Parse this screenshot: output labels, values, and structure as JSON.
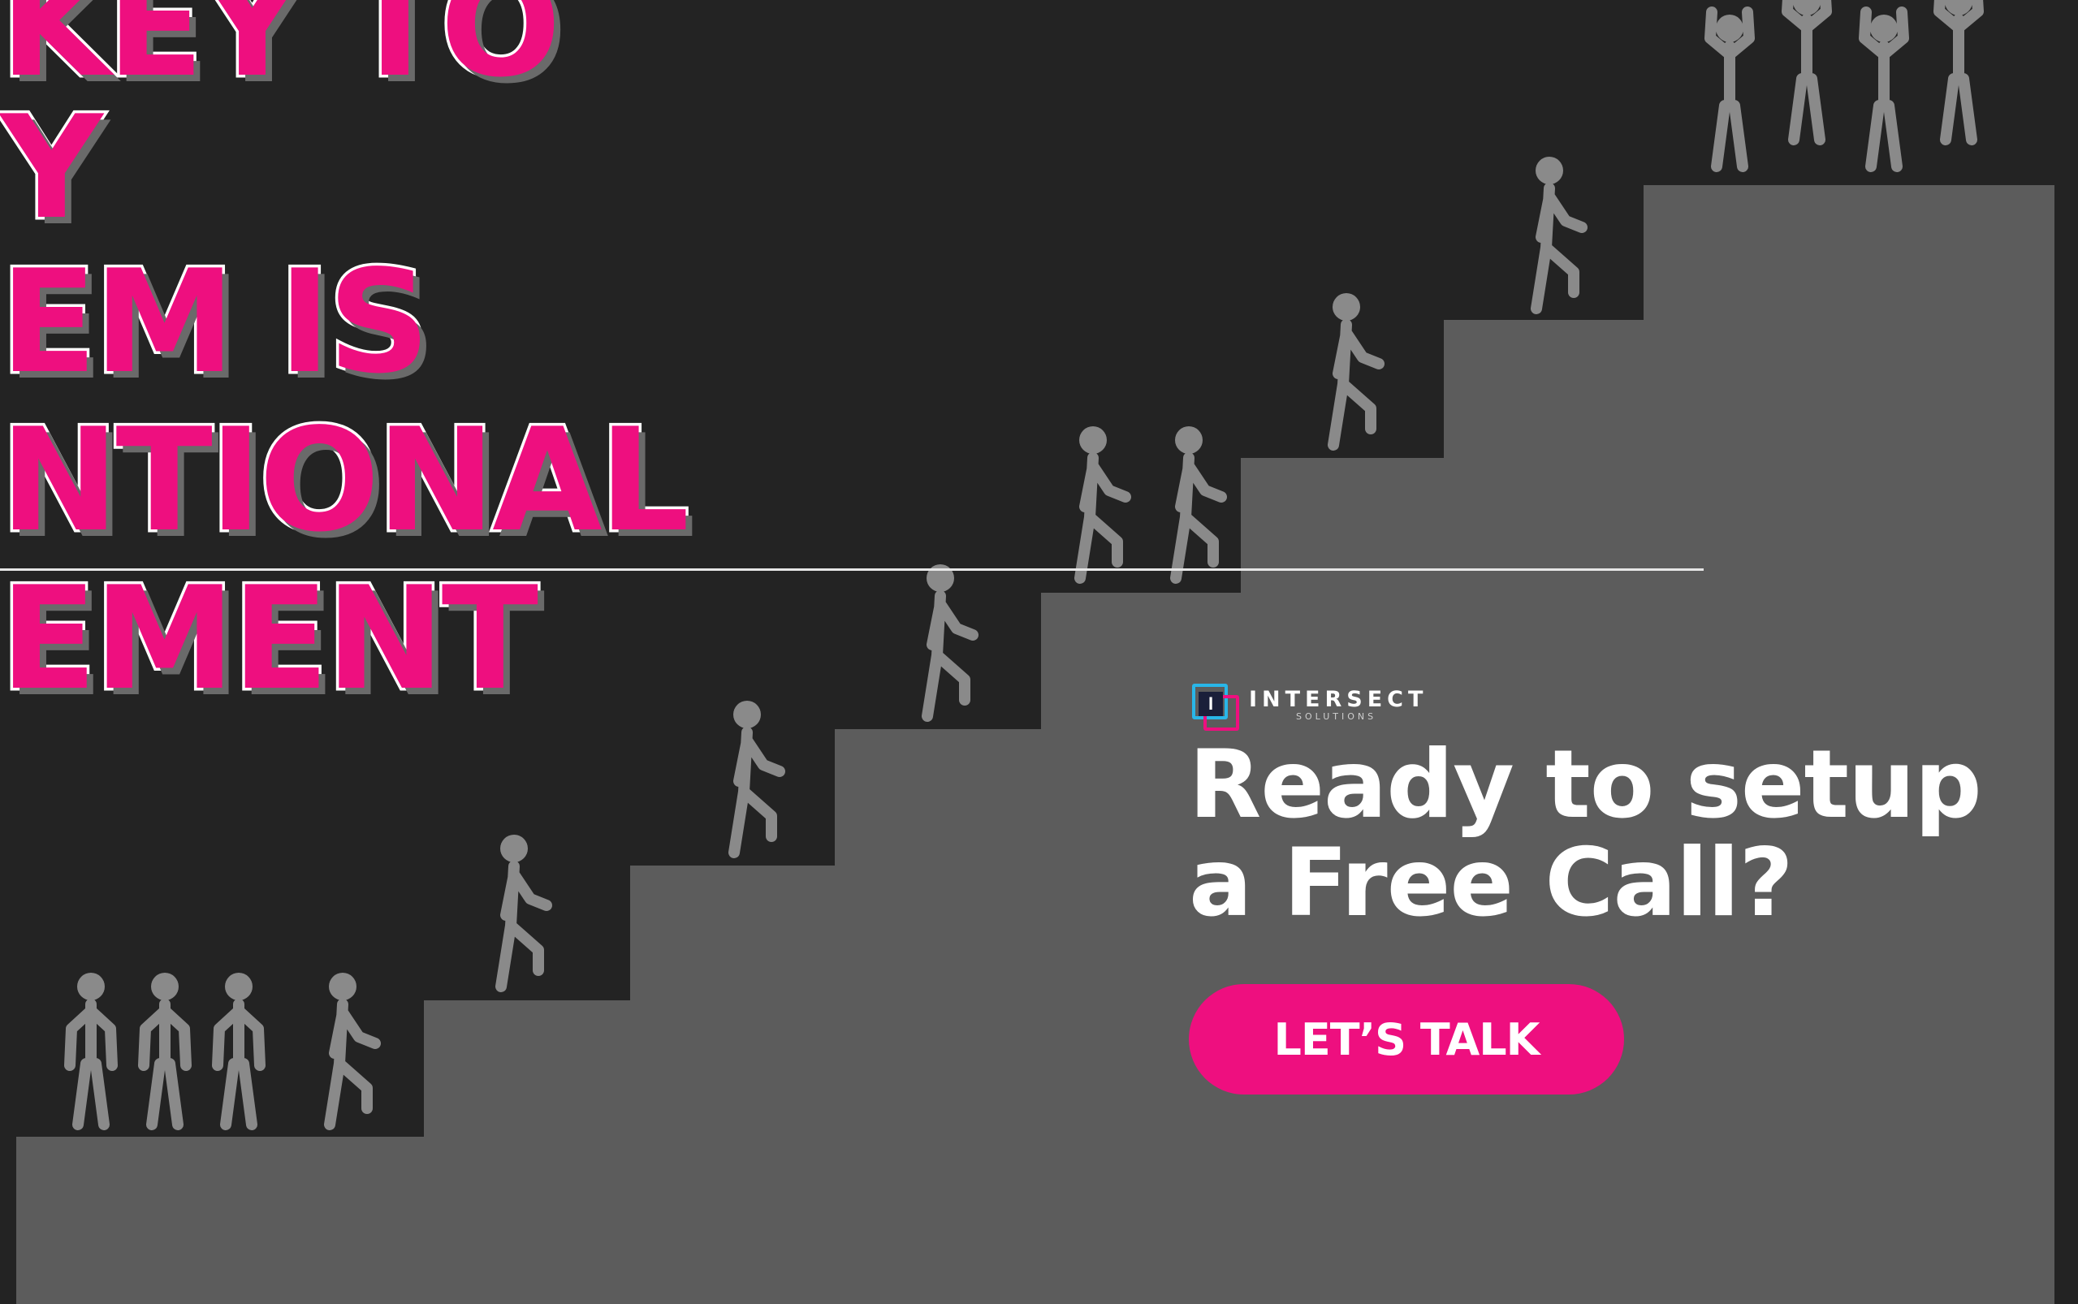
{
  "headline": {
    "lines": [
      "KEY TO",
      "Y",
      "EM IS",
      "NTIONAL",
      "EMENT"
    ]
  },
  "brand": {
    "name": "INTERSECT",
    "tagline": "SOLUTIONS",
    "mark_letter": "I"
  },
  "cta": {
    "title_line1": "Ready to setup",
    "title_line2": "a Free Call?",
    "button_label": "LET’S TALK"
  },
  "colors": {
    "background": "#232323",
    "stairs": "#5c5c5c",
    "figures": "#8a8a8a",
    "accent": "#ee0f7f",
    "text": "#ffffff"
  }
}
